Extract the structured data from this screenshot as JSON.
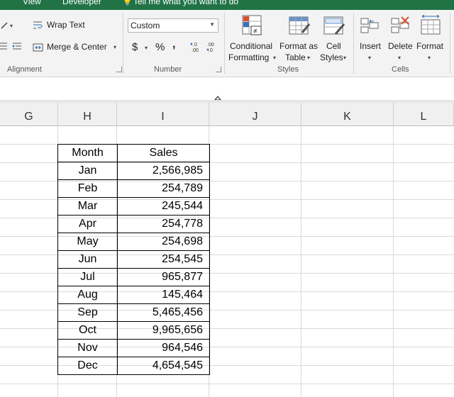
{
  "titlebar": {
    "tab_view": "View",
    "tab_developer": "Developer",
    "tell_me": "Tell me what you want to do"
  },
  "ribbon": {
    "alignment": {
      "wrap_text": "Wrap Text",
      "merge_center": "Merge & Center",
      "group_label": "Alignment"
    },
    "number": {
      "format_value": "Custom",
      "currency": "$",
      "percent": "%",
      "comma": ",",
      "inc_decimal": "←.0\n.00",
      "dec_decimal": ".00\n→.0",
      "group_label": "Number"
    },
    "styles": {
      "conditional_formatting": [
        "Conditional",
        "Formatting"
      ],
      "format_as_table": [
        "Format as",
        "Table"
      ],
      "cell_styles": [
        "Cell",
        "Styles"
      ],
      "group_label": "Styles"
    },
    "cells": {
      "insert": "Insert",
      "delete": "Delete",
      "format": "Format",
      "group_label": "Cells"
    }
  },
  "columns": [
    "G",
    "H",
    "I",
    "J",
    "K",
    "L"
  ],
  "table": {
    "headers": [
      "Month",
      "Sales"
    ],
    "rows": [
      [
        "Jan",
        "2,566,985"
      ],
      [
        "Feb",
        "254,789"
      ],
      [
        "Mar",
        "245,544"
      ],
      [
        "Apr",
        "254,778"
      ],
      [
        "May",
        "254,698"
      ],
      [
        "Jun",
        "254,545"
      ],
      [
        "Jul",
        "965,877"
      ],
      [
        "Aug",
        "145,464"
      ],
      [
        "Sep",
        "5,465,456"
      ],
      [
        "Oct",
        "9,965,656"
      ],
      [
        "Nov",
        "964,546"
      ],
      [
        "Dec",
        "4,654,545"
      ]
    ]
  },
  "colors": {
    "brand_green": "#217346",
    "ribbon_bg": "#f3f3f3"
  }
}
